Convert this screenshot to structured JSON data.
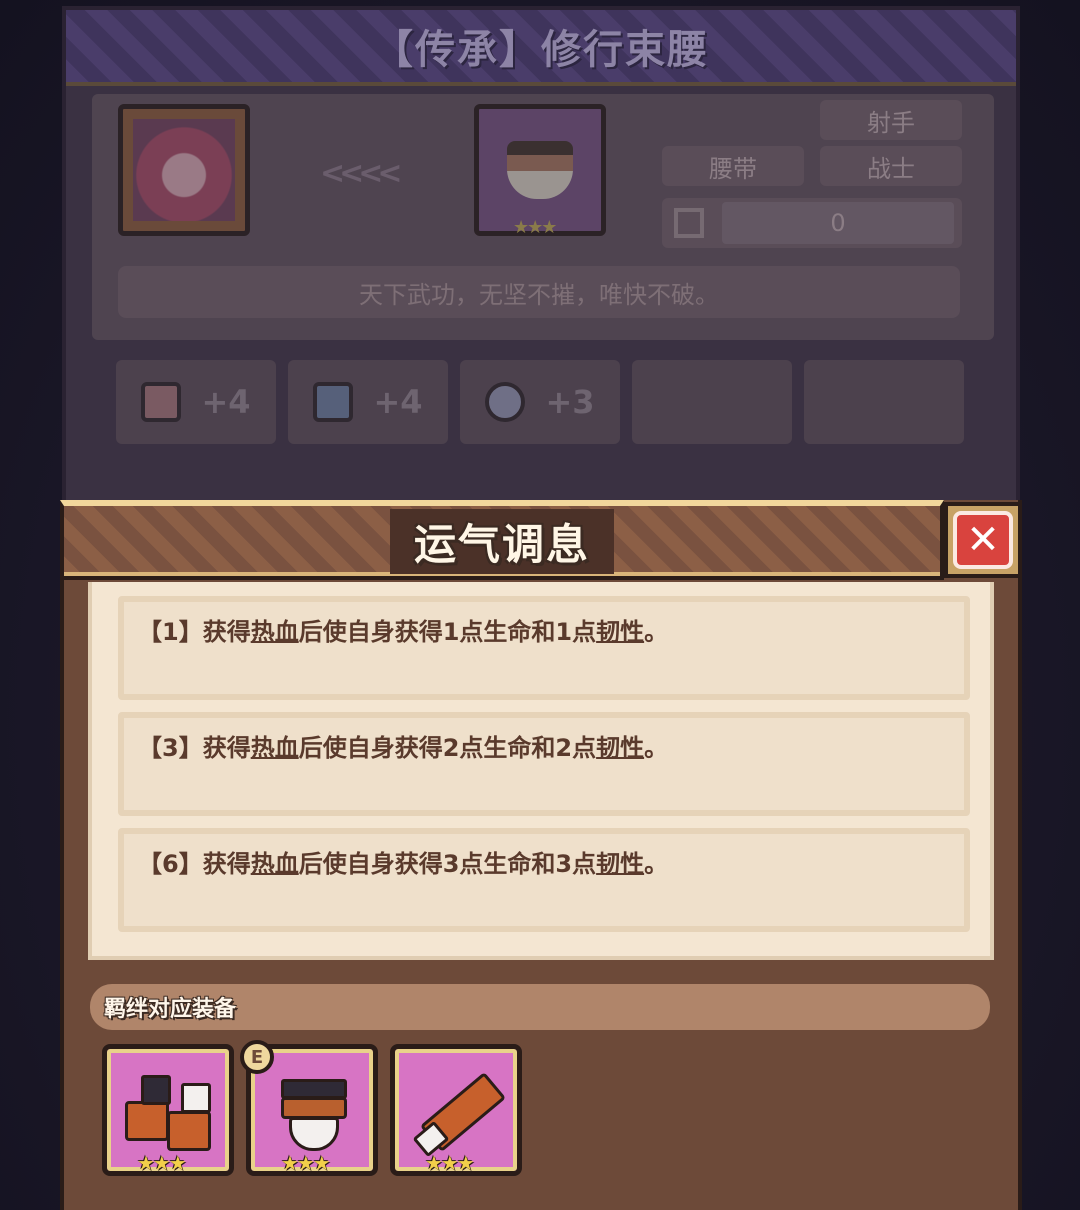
{
  "item_card": {
    "title": "【传承】修行束腰",
    "tags": {
      "type": "腰带",
      "class_1": "射手",
      "class_2": "战士"
    },
    "count": "0",
    "motto": "天下武功，无坚不摧，唯快不破。",
    "item_stars": "★★★",
    "stats": [
      {
        "icon": "shield-stat-icon",
        "value": "+4"
      },
      {
        "icon": "boot-stat-icon",
        "value": "+4"
      },
      {
        "icon": "feather-stat-icon",
        "value": "+3"
      }
    ]
  },
  "modal": {
    "title": "运气调息",
    "close_glyph": "✕",
    "effects": [
      {
        "prefix": "【1】获得",
        "keyword1": "热血",
        "middle": "后使自身获得1点生命和1点",
        "keyword2": "韧性",
        "suffix": "。"
      },
      {
        "prefix": "【3】获得",
        "keyword1": "热血",
        "middle": "后使自身获得2点生命和2点",
        "keyword2": "韧性",
        "suffix": "。"
      },
      {
        "prefix": "【6】获得",
        "keyword1": "热血",
        "middle": "后使自身获得3点生命和3点",
        "keyword2": "韧性",
        "suffix": "。"
      }
    ],
    "bond_label": "羁绊对应装备",
    "equipment": [
      {
        "name": "boots-equipment",
        "stars": "★★★"
      },
      {
        "name": "belt-equipment",
        "stars": "★★★",
        "badge": "E"
      },
      {
        "name": "bracer-equipment",
        "stars": "★★★"
      }
    ]
  },
  "colors": {
    "modal_bg": "#6d4a39",
    "panel_bg": "#f4e6d2",
    "close_red": "#d9433e",
    "equip_purple": "#d774c4",
    "star_gold": "#f2cf4a"
  }
}
